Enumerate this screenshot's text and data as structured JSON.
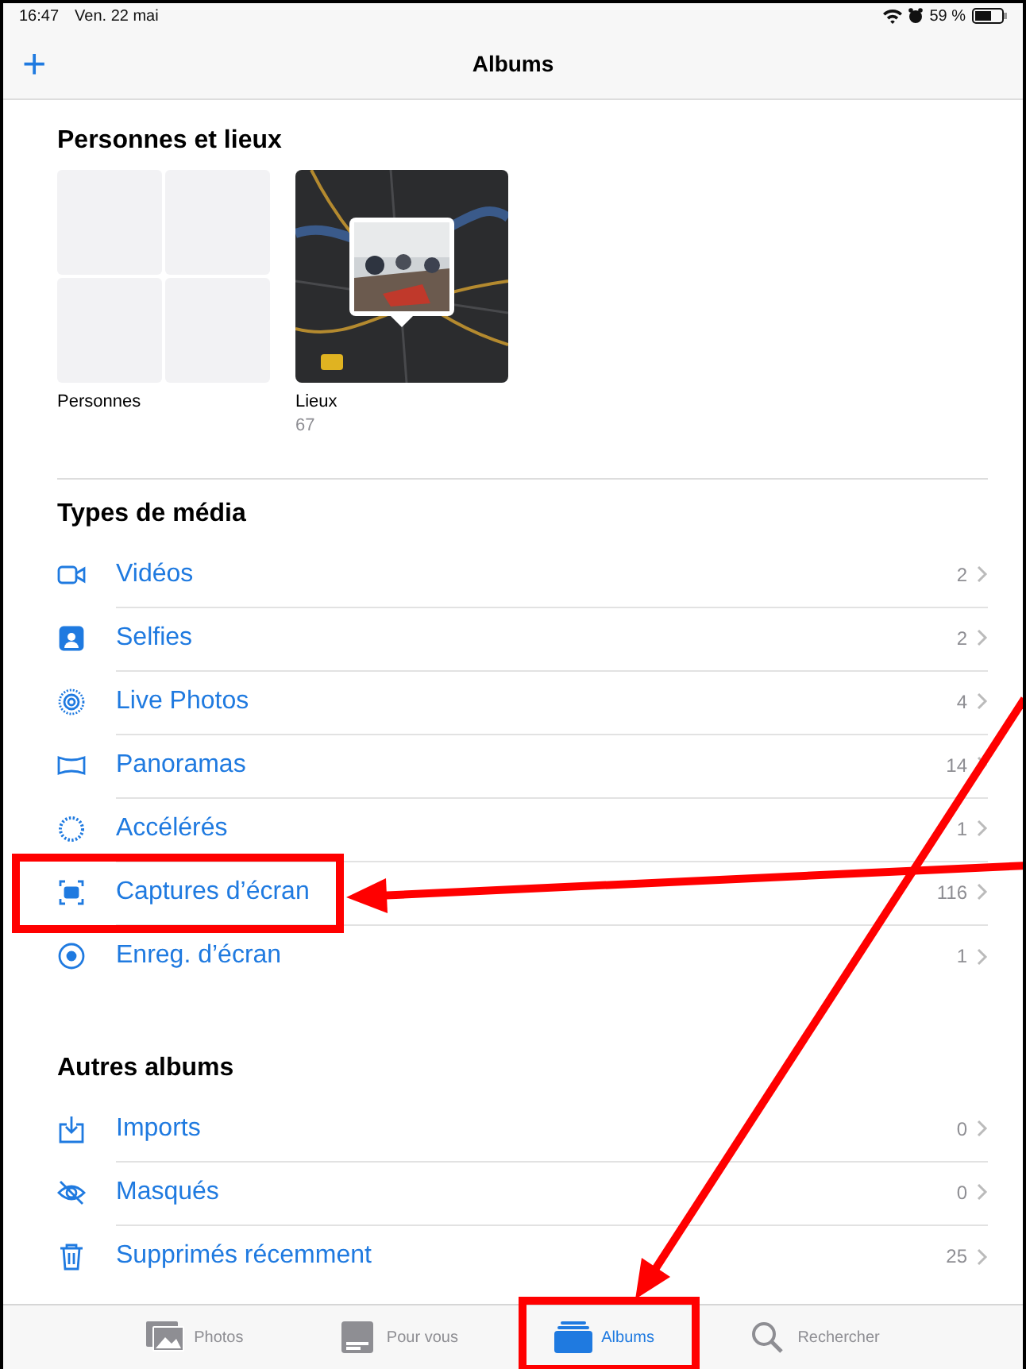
{
  "status_bar": {
    "time": "16:47",
    "date": "Ven. 22 mai",
    "battery": "59 %"
  },
  "nav_bar": {
    "add_button": "+",
    "title": "Albums"
  },
  "people_places": {
    "title": "Personnes et lieux",
    "albums": [
      {
        "kind": "people",
        "name": "Personnes"
      },
      {
        "kind": "map",
        "name": "Lieux",
        "count": "67"
      }
    ]
  },
  "sections": [
    {
      "title": "Types de média",
      "rows": [
        {
          "label": "Vidéos",
          "count": "2"
        },
        {
          "label": "Selfies",
          "count": "2"
        },
        {
          "label": "Live Photos",
          "count": "4"
        },
        {
          "label": "Panoramas",
          "count": "14"
        },
        {
          "label": "Accélérés",
          "count": "1"
        },
        {
          "label": "Captures d’écran",
          "count": "116"
        },
        {
          "label": "Enreg. d’écran",
          "count": "1"
        }
      ]
    },
    {
      "title": "Autres albums",
      "rows": [
        {
          "label": "Imports",
          "count": "0"
        },
        {
          "label": "Masqués",
          "count": "0"
        },
        {
          "label": "Supprimés récemment",
          "count": "25"
        }
      ]
    }
  ],
  "tab_bar": [
    {
      "label": "Photos",
      "selected": false
    },
    {
      "label": "Pour vous",
      "selected": false
    },
    {
      "label": "Albums",
      "selected": true
    },
    {
      "label": "Rechercher",
      "selected": false
    }
  ]
}
